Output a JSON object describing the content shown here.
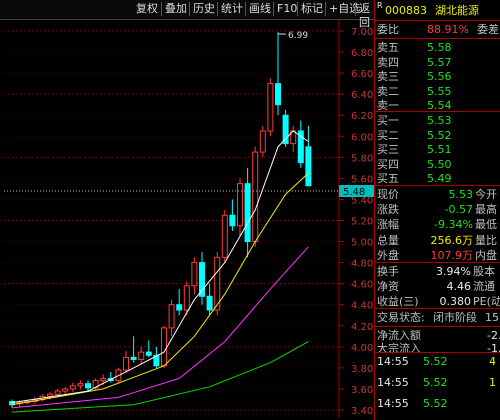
{
  "toolbar": {
    "buttons": [
      "复权",
      "叠加",
      "历史",
      "统计",
      "画线",
      "F10",
      "标记",
      "+自选",
      "返回"
    ]
  },
  "stock": {
    "marker": "R",
    "code": "000883",
    "name": "湖北能源"
  },
  "weibi": {
    "label": "委比",
    "value": "88.91%",
    "diff_label": "委差"
  },
  "asks": [
    {
      "label": "卖五",
      "price": "5.58"
    },
    {
      "label": "卖四",
      "price": "5.57"
    },
    {
      "label": "卖三",
      "price": "5.56"
    },
    {
      "label": "卖二",
      "price": "5.55"
    },
    {
      "label": "卖一",
      "price": "5.54"
    }
  ],
  "bids": [
    {
      "label": "买一",
      "price": "5.53"
    },
    {
      "label": "买二",
      "price": "5.52"
    },
    {
      "label": "买三",
      "price": "5.51"
    },
    {
      "label": "买四",
      "price": "5.50"
    },
    {
      "label": "买五",
      "price": "5.49"
    }
  ],
  "quote": [
    {
      "l1": "现价",
      "v1": "5.53",
      "l2": "今开",
      "c1": "green"
    },
    {
      "l1": "涨跌",
      "v1": "-0.57",
      "l2": "最高",
      "c1": "green"
    },
    {
      "l1": "涨幅",
      "v1": "-9.34%",
      "l2": "最低",
      "c1": "green"
    },
    {
      "l1": "总量",
      "v1": "256.6万",
      "l2": "量比",
      "c1": "yellow"
    },
    {
      "l1": "外盘",
      "v1": "107.9万",
      "l2": "内盘",
      "c1": "red"
    }
  ],
  "stats": [
    {
      "l1": "换手",
      "v1": "3.94%",
      "l2": "股本"
    },
    {
      "l1": "净资",
      "v1": "4.46",
      "l2": "流通"
    },
    {
      "l1": "收益(三)",
      "v1": "0.380",
      "l2": "PE(动)"
    }
  ],
  "status": {
    "label": "交易状态:",
    "value": "闭市阶段",
    "time": "15:"
  },
  "flow": [
    {
      "label": "净流入额",
      "value": "-2."
    },
    {
      "label": "大宗流入",
      "value": "-1."
    }
  ],
  "ticks": [
    {
      "time": "14:55",
      "price": "5.52",
      "vol": "4"
    },
    {
      "time": "14:55",
      "price": "5.52",
      "vol": "1"
    },
    {
      "time": "14:55",
      "price": "5.52",
      "vol": ""
    }
  ],
  "colors": {
    "up": "#ff3b3b",
    "down": "#00ffff",
    "ma5": "#ffffff",
    "ma10": "#f0f000",
    "ma20": "#ff33ff",
    "ma60": "#00dd00"
  },
  "chart_data": {
    "type": "candlestick",
    "y_ticks": [
      "7.00",
      "6.80",
      "6.60",
      "6.40",
      "6.20",
      "6.00",
      "5.80",
      "5.60",
      "5.40",
      "5.20",
      "5.00",
      "4.80",
      "4.60",
      "4.40",
      "4.20",
      "4.00",
      "3.80",
      "3.60",
      "3.40"
    ],
    "ylim": [
      3.36,
      7.1
    ],
    "high_label": "6.99",
    "current_label": "5.48",
    "candles": [
      {
        "o": 3.48,
        "h": 3.5,
        "l": 3.42,
        "c": 3.45
      },
      {
        "o": 3.46,
        "h": 3.49,
        "l": 3.43,
        "c": 3.47
      },
      {
        "o": 3.47,
        "h": 3.5,
        "l": 3.45,
        "c": 3.48
      },
      {
        "o": 3.48,
        "h": 3.52,
        "l": 3.46,
        "c": 3.5
      },
      {
        "o": 3.5,
        "h": 3.55,
        "l": 3.48,
        "c": 3.53
      },
      {
        "o": 3.53,
        "h": 3.57,
        "l": 3.5,
        "c": 3.55
      },
      {
        "o": 3.55,
        "h": 3.6,
        "l": 3.52,
        "c": 3.58
      },
      {
        "o": 3.58,
        "h": 3.62,
        "l": 3.55,
        "c": 3.6
      },
      {
        "o": 3.6,
        "h": 3.66,
        "l": 3.57,
        "c": 3.63
      },
      {
        "o": 3.63,
        "h": 3.68,
        "l": 3.6,
        "c": 3.65
      },
      {
        "o": 3.65,
        "h": 3.68,
        "l": 3.58,
        "c": 3.61
      },
      {
        "o": 3.61,
        "h": 3.7,
        "l": 3.59,
        "c": 3.68
      },
      {
        "o": 3.68,
        "h": 3.74,
        "l": 3.64,
        "c": 3.7
      },
      {
        "o": 3.7,
        "h": 3.76,
        "l": 3.66,
        "c": 3.68
      },
      {
        "o": 3.68,
        "h": 3.8,
        "l": 3.66,
        "c": 3.78
      },
      {
        "o": 3.78,
        "h": 3.96,
        "l": 3.75,
        "c": 3.9
      },
      {
        "o": 3.9,
        "h": 4.1,
        "l": 3.85,
        "c": 3.88
      },
      {
        "o": 3.88,
        "h": 4.0,
        "l": 3.84,
        "c": 3.95
      },
      {
        "o": 3.95,
        "h": 4.06,
        "l": 3.9,
        "c": 3.92
      },
      {
        "o": 3.92,
        "h": 4.0,
        "l": 3.8,
        "c": 3.82
      },
      {
        "o": 3.82,
        "h": 4.2,
        "l": 3.8,
        "c": 4.18
      },
      {
        "o": 4.18,
        "h": 4.45,
        "l": 4.1,
        "c": 4.4
      },
      {
        "o": 4.4,
        "h": 4.55,
        "l": 4.3,
        "c": 4.35
      },
      {
        "o": 4.35,
        "h": 4.62,
        "l": 4.3,
        "c": 4.58
      },
      {
        "o": 4.58,
        "h": 4.85,
        "l": 4.5,
        "c": 4.8
      },
      {
        "o": 4.8,
        "h": 4.9,
        "l": 4.4,
        "c": 4.48
      },
      {
        "o": 4.48,
        "h": 4.6,
        "l": 4.3,
        "c": 4.35
      },
      {
        "o": 4.35,
        "h": 4.9,
        "l": 4.3,
        "c": 4.85
      },
      {
        "o": 4.85,
        "h": 5.3,
        "l": 4.8,
        "c": 5.25
      },
      {
        "o": 5.25,
        "h": 5.4,
        "l": 5.1,
        "c": 5.15
      },
      {
        "o": 5.15,
        "h": 5.6,
        "l": 5.05,
        "c": 5.55
      },
      {
        "o": 5.55,
        "h": 5.7,
        "l": 4.85,
        "c": 5.0
      },
      {
        "o": 5.0,
        "h": 5.9,
        "l": 4.95,
        "c": 5.85
      },
      {
        "o": 5.85,
        "h": 6.1,
        "l": 5.8,
        "c": 6.05
      },
      {
        "o": 6.05,
        "h": 6.55,
        "l": 6.0,
        "c": 6.5
      },
      {
        "o": 6.5,
        "h": 6.99,
        "l": 6.2,
        "c": 6.3
      },
      {
        "o": 6.2,
        "h": 6.25,
        "l": 5.9,
        "c": 5.93
      },
      {
        "o": 5.93,
        "h": 6.1,
        "l": 5.85,
        "c": 6.05
      },
      {
        "o": 6.05,
        "h": 6.15,
        "l": 5.7,
        "c": 5.75
      },
      {
        "o": 5.9,
        "h": 6.1,
        "l": 5.55,
        "c": 5.53
      }
    ],
    "ma5": [
      [
        0,
        3.47
      ],
      [
        10,
        3.58
      ],
      [
        16,
        3.8
      ],
      [
        20,
        3.95
      ],
      [
        24,
        4.45
      ],
      [
        28,
        4.8
      ],
      [
        32,
        5.3
      ],
      [
        35,
        5.9
      ],
      [
        37,
        6.05
      ],
      [
        39,
        5.95
      ]
    ],
    "ma10": [
      [
        0,
        3.45
      ],
      [
        12,
        3.6
      ],
      [
        20,
        3.82
      ],
      [
        24,
        4.1
      ],
      [
        28,
        4.5
      ],
      [
        32,
        5.0
      ],
      [
        36,
        5.45
      ],
      [
        39,
        5.65
      ]
    ],
    "ma20": [
      [
        0,
        3.42
      ],
      [
        14,
        3.52
      ],
      [
        22,
        3.7
      ],
      [
        28,
        4.05
      ],
      [
        34,
        4.55
      ],
      [
        39,
        4.95
      ]
    ],
    "ma60": [
      [
        0,
        3.38
      ],
      [
        16,
        3.45
      ],
      [
        26,
        3.62
      ],
      [
        34,
        3.85
      ],
      [
        39,
        4.05
      ]
    ]
  }
}
